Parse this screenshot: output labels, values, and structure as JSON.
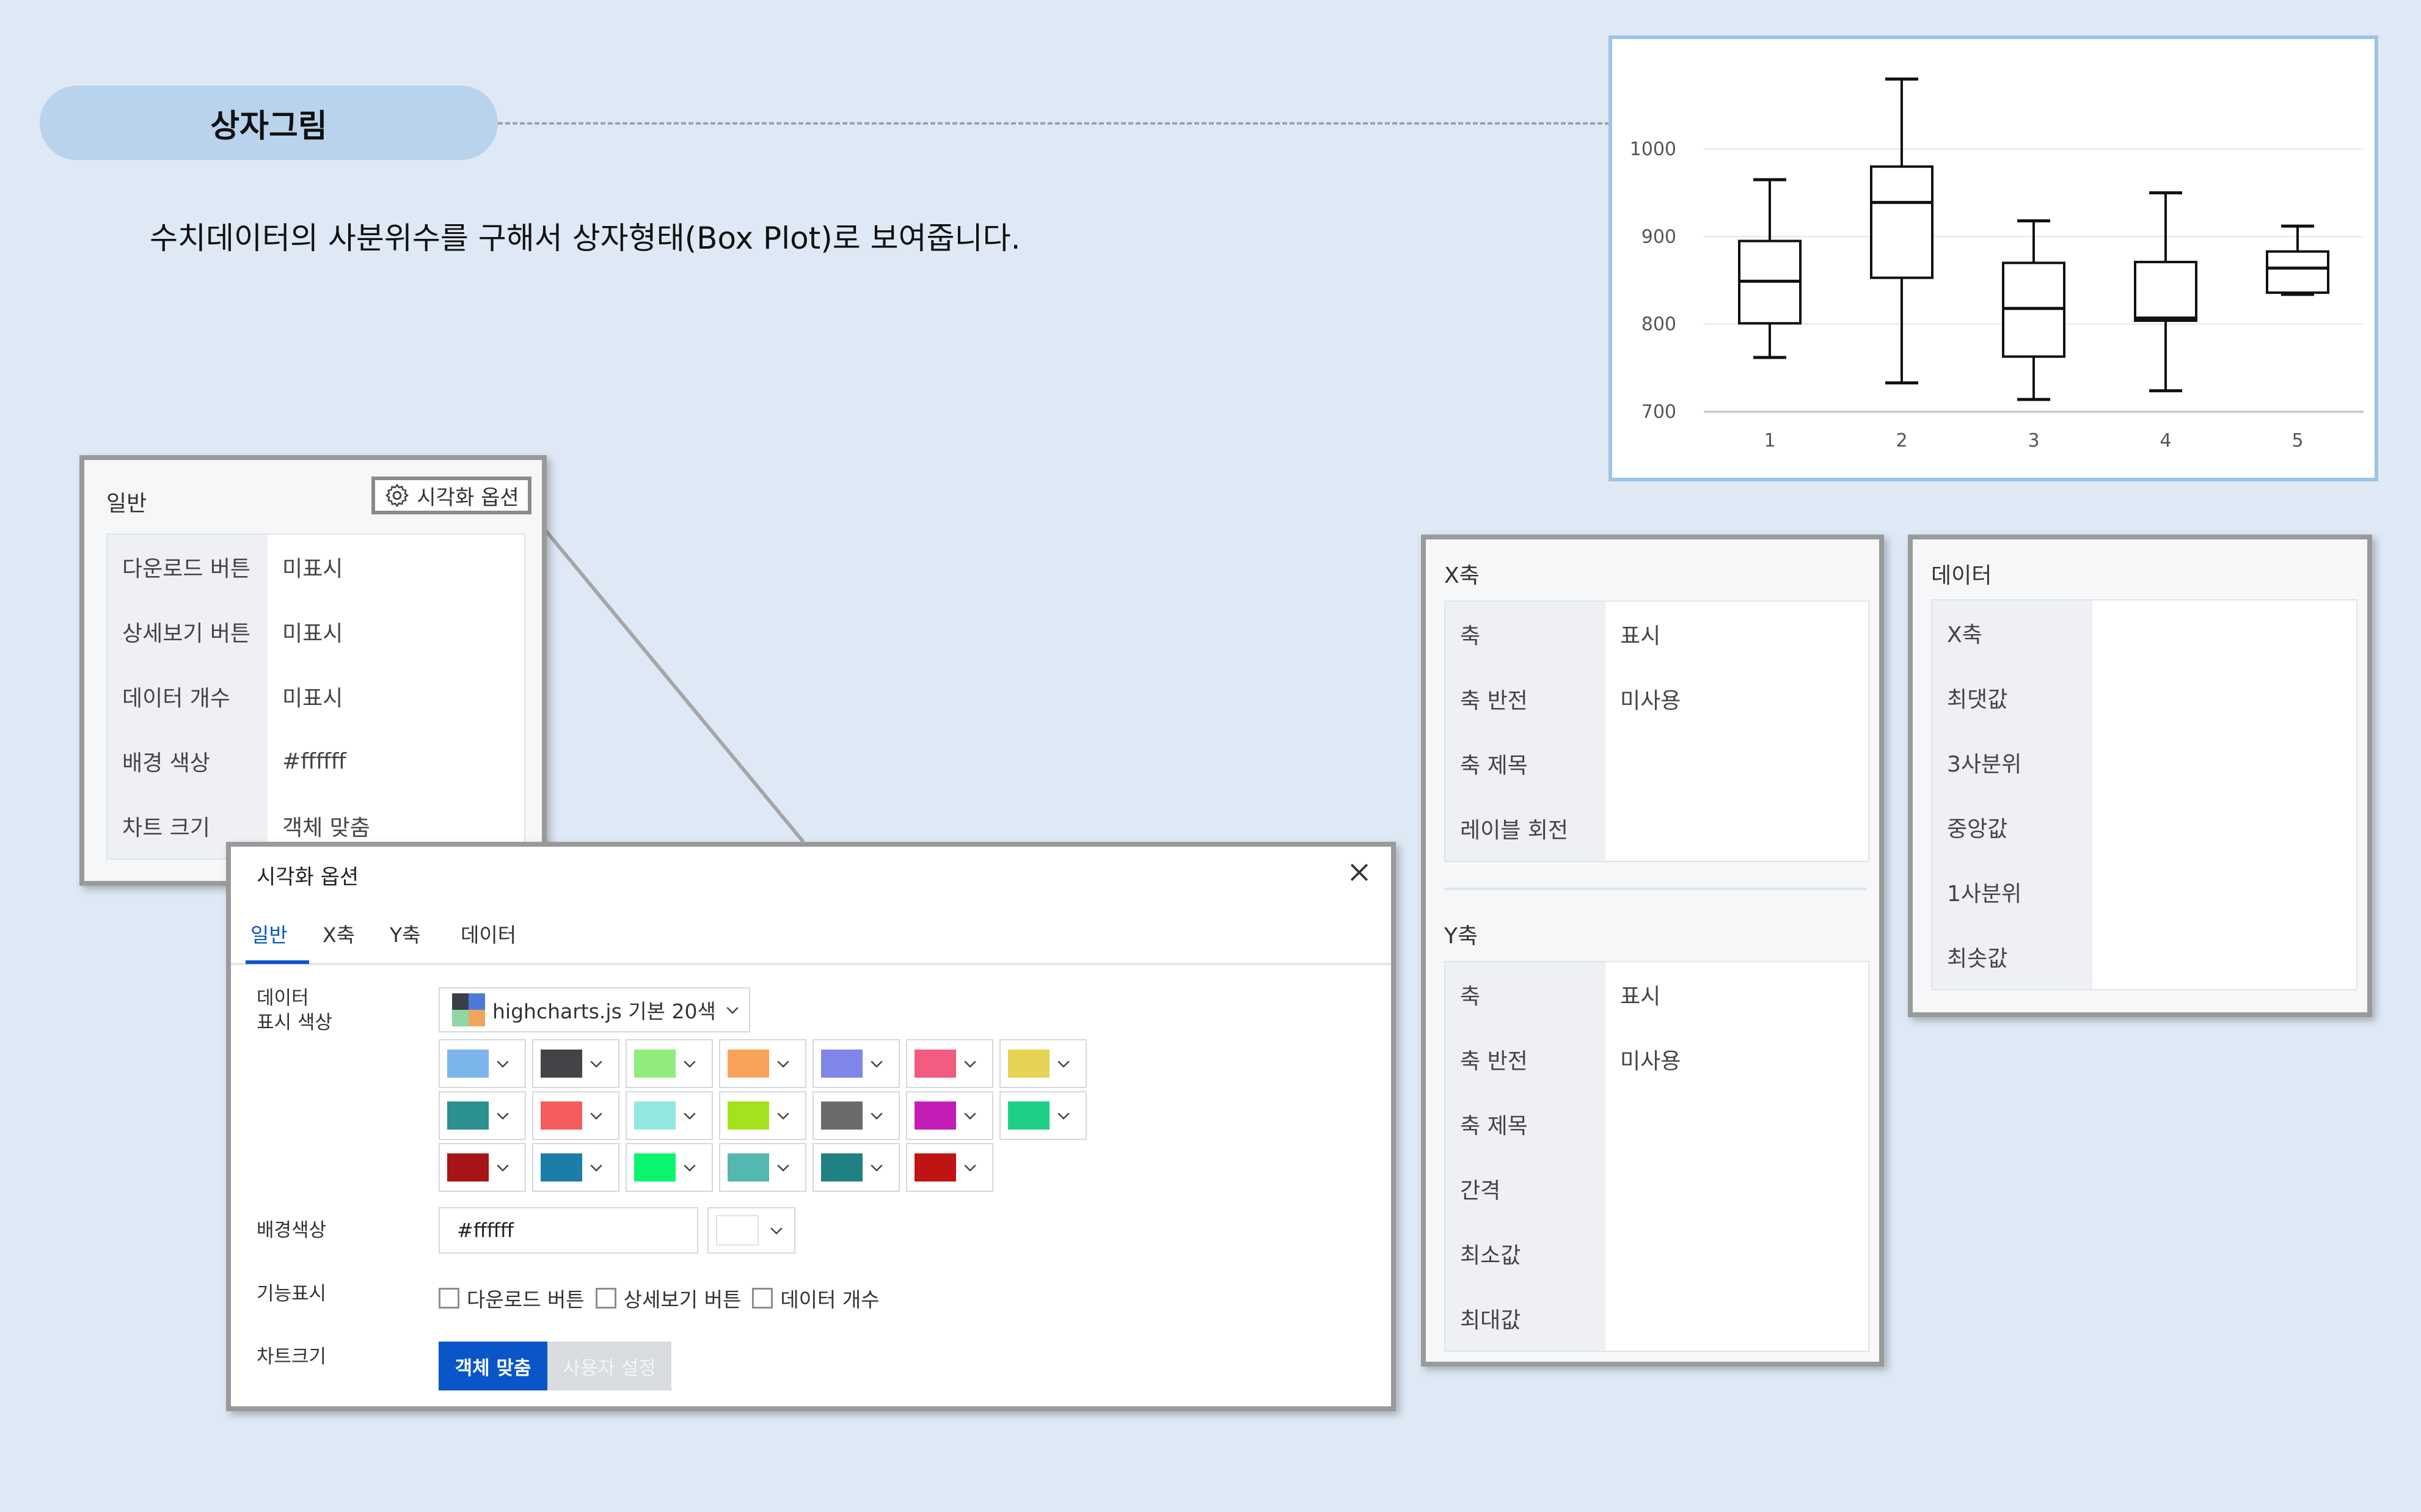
{
  "header": {
    "title": "상자그림",
    "description": "수치데이터의 사분위수를 구해서 상자형태(Box Plot)로 보여줍니다."
  },
  "chart_data": {
    "type": "boxplot",
    "categories": [
      "1",
      "2",
      "3",
      "4",
      "5"
    ],
    "boxes": [
      {
        "x": "1",
        "low": 762,
        "q1": 801,
        "median": 849,
        "q3": 895,
        "high": 965
      },
      {
        "x": "2",
        "low": 733,
        "q1": 853,
        "median": 939,
        "q3": 980,
        "high": 1080
      },
      {
        "x": "3",
        "low": 714,
        "q1": 763,
        "median": 818,
        "q3": 870,
        "high": 918
      },
      {
        "x": "4",
        "low": 724,
        "q1": 804,
        "median": 807,
        "q3": 871,
        "high": 950
      },
      {
        "x": "5",
        "low": 834,
        "q1": 836,
        "median": 864,
        "q3": 883,
        "high": 912
      }
    ],
    "y_ticks": [
      "700",
      "800",
      "900",
      "1000"
    ],
    "ylim": [
      700,
      1080
    ],
    "grid": true,
    "legend": false
  },
  "general_panel": {
    "title": "일반",
    "options_button": "시각화 옵션",
    "rows": [
      {
        "key": "다운로드 버튼",
        "value": "미표시"
      },
      {
        "key": "상세보기 버튼",
        "value": "미표시"
      },
      {
        "key": "데이터 개수",
        "value": "미표시"
      },
      {
        "key": "배경 색상",
        "value": "#ffffff"
      },
      {
        "key": "차트 크기",
        "value": "객체 맞춤"
      }
    ]
  },
  "xaxis_panel": {
    "title": "X축",
    "rows": [
      {
        "key": "축",
        "value": "표시"
      },
      {
        "key": "축 반전",
        "value": "미사용"
      },
      {
        "key": "축 제목",
        "value": ""
      },
      {
        "key": "레이블 회전",
        "value": ""
      }
    ]
  },
  "yaxis_panel": {
    "title": "Y축",
    "rows": [
      {
        "key": "축",
        "value": "표시"
      },
      {
        "key": "축 반전",
        "value": "미사용"
      },
      {
        "key": "축 제목",
        "value": ""
      },
      {
        "key": "간격",
        "value": ""
      },
      {
        "key": "최소값",
        "value": ""
      },
      {
        "key": "최대값",
        "value": ""
      }
    ]
  },
  "data_panel": {
    "title": "데이터",
    "rows": [
      {
        "key": "X축",
        "value": ""
      },
      {
        "key": "최댓값",
        "value": ""
      },
      {
        "key": "3사분위",
        "value": ""
      },
      {
        "key": "중앙값",
        "value": ""
      },
      {
        "key": "1사분위",
        "value": ""
      },
      {
        "key": "최솟값",
        "value": ""
      }
    ]
  },
  "dialog": {
    "title": "시각화 옵션",
    "tabs": [
      "일반",
      "X축",
      "Y축",
      "데이터"
    ],
    "data_color_label_1": "데이터",
    "data_color_label_2": "표시 색상",
    "palette_name": "highcharts.js 기본 20색",
    "palette_colors": [
      [
        "#7cb5ec",
        "#434348",
        "#90ed7d",
        "#f7a35c",
        "#8085e9",
        "#f15c80",
        "#e4d354"
      ],
      [
        "#2b908f",
        "#f45b5b",
        "#91e8e1",
        "#a5e21d",
        "#6b6b6b",
        "#c21db5",
        "#1ecf86"
      ],
      [
        "#a51515",
        "#1c7ea8",
        "#0af56d",
        "#55b8b0",
        "#1f8182",
        "#c01414"
      ]
    ],
    "bg_color_label": "배경색상",
    "bg_color_value": "#ffffff",
    "feature_label": "기능표시",
    "checkboxes": [
      "다운로드 버튼",
      "상세보기 버튼",
      "데이터 개수"
    ],
    "chart_size_label": "차트크기",
    "size_options": [
      "객체 맞춤",
      "사용자 설정"
    ]
  }
}
